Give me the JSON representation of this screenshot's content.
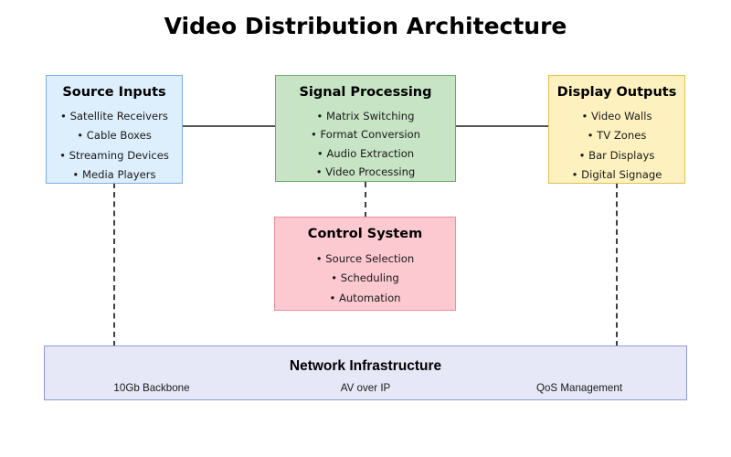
{
  "diagram": {
    "title": "Video Distribution Architecture",
    "background_color": "#ffffff",
    "nodes": [
      {
        "id": "source-inputs",
        "title": "Source Inputs",
        "items": [
          "• Satellite Receivers",
          "• Cable Boxes",
          "• Streaming Devices",
          "• Media Players"
        ],
        "fill_color": "#ddeefc",
        "border_color": "#7aade0"
      },
      {
        "id": "signal-processing",
        "title": "Signal Processing",
        "items": [
          "• Matrix Switching",
          "• Format Conversion",
          "• Audio Extraction",
          "• Video Processing"
        ],
        "fill_color": "#c7e4c4",
        "border_color": "#6aab67"
      },
      {
        "id": "display-outputs",
        "title": "Display Outputs",
        "items": [
          "• Video Walls",
          "• TV Zones",
          "• Bar Displays",
          "• Digital Signage"
        ],
        "fill_color": "#fdf2bf",
        "border_color": "#e3be52"
      },
      {
        "id": "control-system",
        "title": "Control System",
        "items": [
          "• Source Selection",
          "• Scheduling",
          "• Automation"
        ],
        "fill_color": "#fbc9cf",
        "border_color": "#ef8e9c"
      }
    ],
    "network": {
      "title": "Network Infrastructure",
      "sublabels": [
        "10Gb Backbone",
        "AV over IP",
        "QoS Management"
      ],
      "fill_color": "#e6e8f7",
      "border_color": "#8f9ad8"
    },
    "connectors": {
      "solid_color": "#555555",
      "dashed_color": "#3f3f3f",
      "links": [
        {
          "from": "source-inputs",
          "to": "signal-processing",
          "style": "solid"
        },
        {
          "from": "signal-processing",
          "to": "display-outputs",
          "style": "solid"
        },
        {
          "from": "signal-processing",
          "to": "control-system",
          "style": "dashed"
        },
        {
          "from": "source-inputs",
          "to": "network-infrastructure",
          "style": "dashed"
        },
        {
          "from": "display-outputs",
          "to": "network-infrastructure",
          "style": "dashed"
        }
      ]
    }
  }
}
